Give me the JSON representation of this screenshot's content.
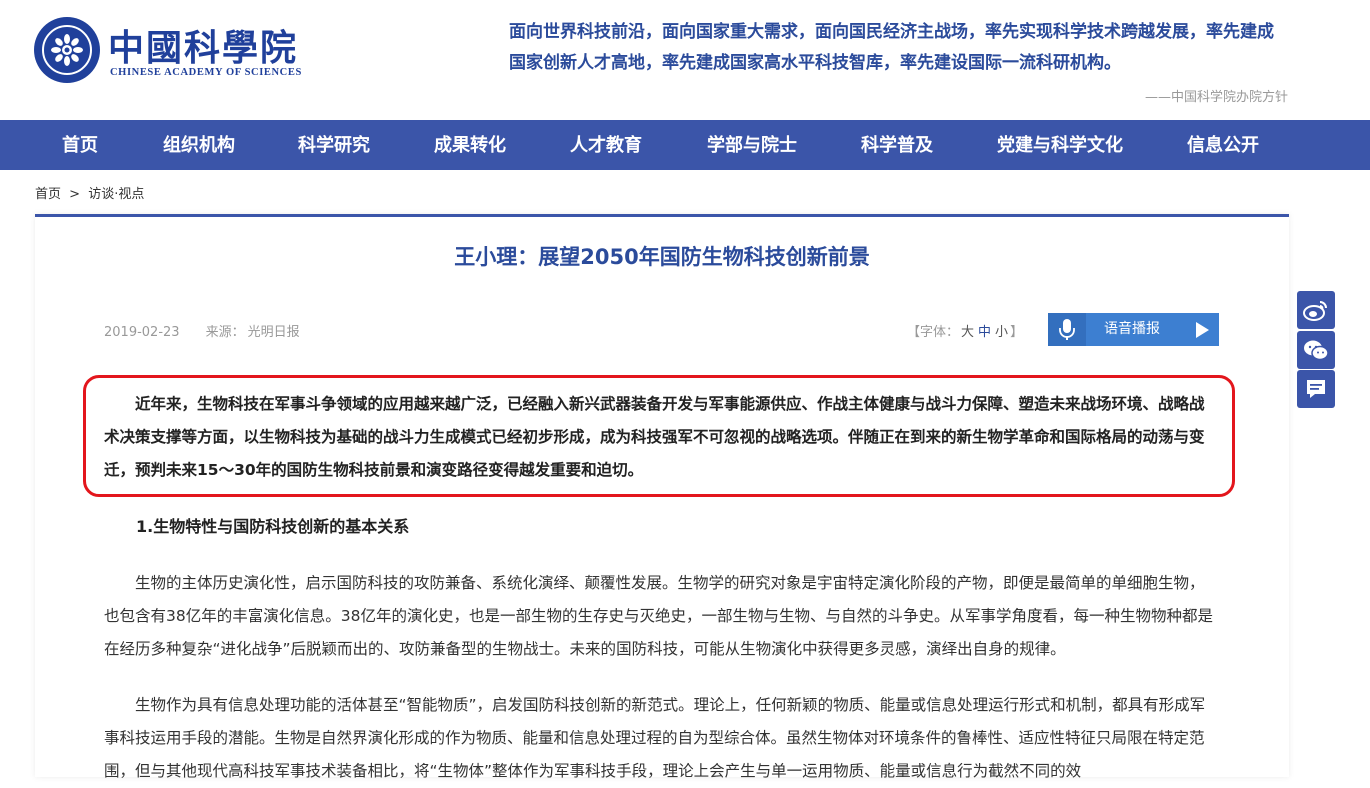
{
  "header": {
    "logo_cn": "中國科學院",
    "logo_en": "CHINESE ACADEMY OF SCIENCES",
    "motto": "面向世界科技前沿，面向国家重大需求，面向国民经济主战场，率先实现科学技术跨越发展，率先建成国家创新人才高地，率先建成国家高水平科技智库，率先建设国际一流科研机构。",
    "motto_source": "——中国科学院办院方针"
  },
  "nav": {
    "items": [
      "首页",
      "组织机构",
      "科学研究",
      "成果转化",
      "人才教育",
      "学部与院士",
      "科学普及",
      "党建与科学文化",
      "信息公开"
    ]
  },
  "breadcrumb": {
    "home": "首页",
    "sep": ">",
    "current": "访谈·视点"
  },
  "article": {
    "title": "王小理：展望2050年国防生物科技创新前景",
    "date": "2019-02-23",
    "source_label": "来源：",
    "source": "光明日报",
    "font_prefix": "【字体：",
    "font_large": "大",
    "font_medium": "中",
    "font_small": "小",
    "font_suffix": "】",
    "voice_label": "语音播报",
    "lead": "近年来，生物科技在军事斗争领域的应用越来越广泛，已经融入新兴武器装备开发与军事能源供应、作战主体健康与战斗力保障、塑造未来战场环境、战略战术决策支撑等方面，以生物科技为基础的战斗力生成模式已经初步形成，成为科技强军不可忽视的战略选项。伴随正在到来的新生物学革命和国际格局的动荡与变迁，预判未来15～30年的国防生物科技前景和演变路径变得越发重要和迫切。",
    "section1": "1.生物特性与国防科技创新的基本关系",
    "p1": "生物的主体历史演化性，启示国防科技的攻防兼备、系统化演绎、颠覆性发展。生物学的研究对象是宇宙特定演化阶段的产物，即便是最简单的单细胞生物，也包含有38亿年的丰富演化信息。38亿年的演化史，也是一部生物的生存史与灭绝史，一部生物与生物、与自然的斗争史。从军事学角度看，每一种生物物种都是在经历多种复杂“进化战争”后脱颖而出的、攻防兼备型的生物战士。未来的国防科技，可能从生物演化中获得更多灵感，演绎出自身的规律。",
    "p2": "生物作为具有信息处理功能的活体甚至“智能物质”，启发国防科技创新的新范式。理论上，任何新颖的物质、能量或信息处理运行形式和机制，都具有形成军事科技运用手段的潜能。生物是自然界演化形成的作为物质、能量和信息处理过程的自为型综合体。虽然生物体对环境条件的鲁棒性、适应性特征只局限在特定范围，但与其他现代高科技军事技术装备相比，将“生物体”整体作为军事科技手段，理论上会产生与单一运用物质、能量或信息行为截然不同的效"
  },
  "colors": {
    "brand": "#3b55a9",
    "title": "#2b4b9b",
    "highlight": "#e3161c",
    "voice": "#3d7fd1"
  },
  "share": {
    "icons": [
      "weibo-icon",
      "wechat-icon",
      "comment-icon"
    ]
  }
}
